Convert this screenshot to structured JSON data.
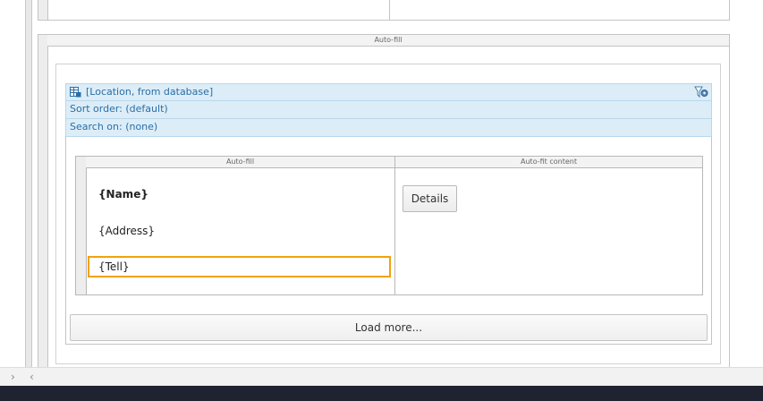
{
  "auto_fill_section": {
    "header": "Auto-fill"
  },
  "datasource": {
    "title": "[Location, from database]",
    "sort_order": "Sort order: (default)",
    "search_on": "Search on: (none)"
  },
  "inner_table": {
    "col1_header": "Auto-fill",
    "col2_header": "Auto-fit content",
    "fields": {
      "name": "{Name}",
      "address": "{Address}",
      "tell": "{Tell}"
    },
    "details_button": "Details"
  },
  "load_more_button": "Load more...",
  "navigation": {
    "forward": "›",
    "back": "‹"
  },
  "colors": {
    "selection": "#f0a30a",
    "datasource_bg": "#dcedf8",
    "datasource_text": "#2a6ea6",
    "taskbar": "#1f2331"
  }
}
